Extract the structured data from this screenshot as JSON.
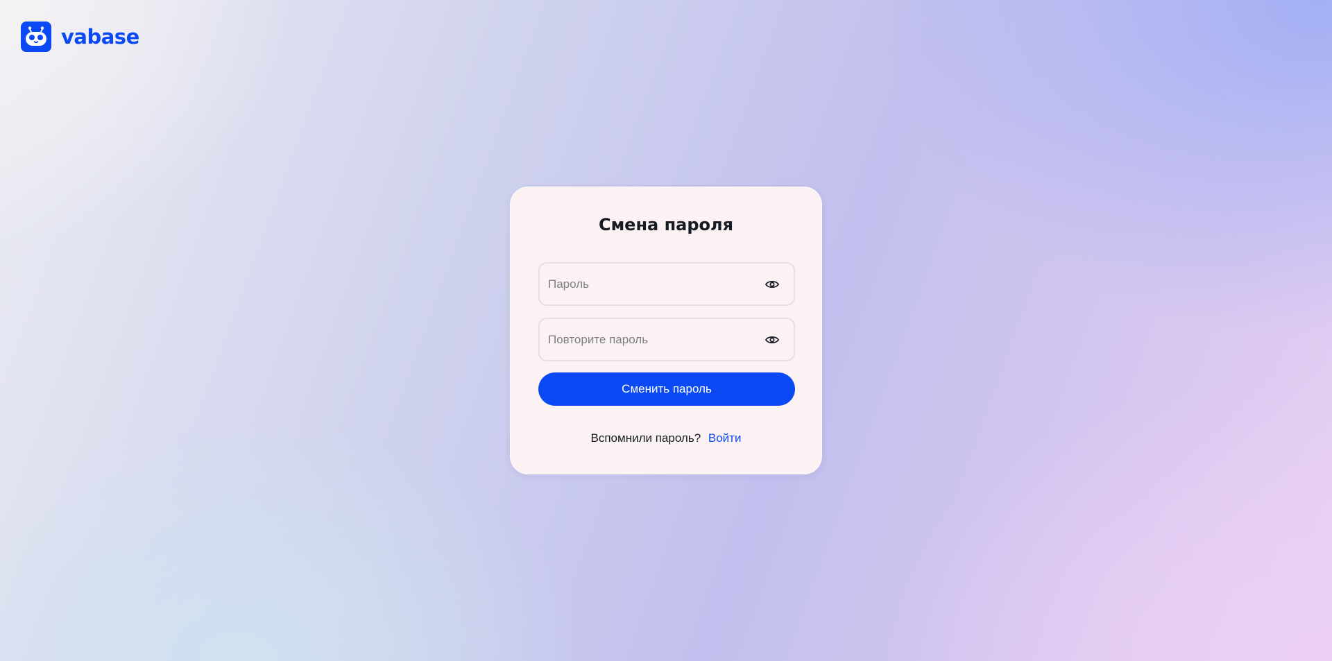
{
  "brand": {
    "name": "vabase",
    "color": "#0b49f5",
    "logo_icon": "robot-face-icon"
  },
  "form": {
    "title": "Смена пароля",
    "password_placeholder": "Пароль",
    "password_value": "",
    "repeat_placeholder": "Повторите пароль",
    "repeat_value": "",
    "show_password_icon": "eye-icon",
    "submit_label": "Сменить пароль",
    "remembered_text": "Вспомнили пароль?",
    "login_link": "Войти"
  },
  "colors": {
    "accent": "#0b49f5",
    "card_background": "#fcf2f3",
    "text": "#161a22",
    "placeholder": "#7d7f86"
  }
}
